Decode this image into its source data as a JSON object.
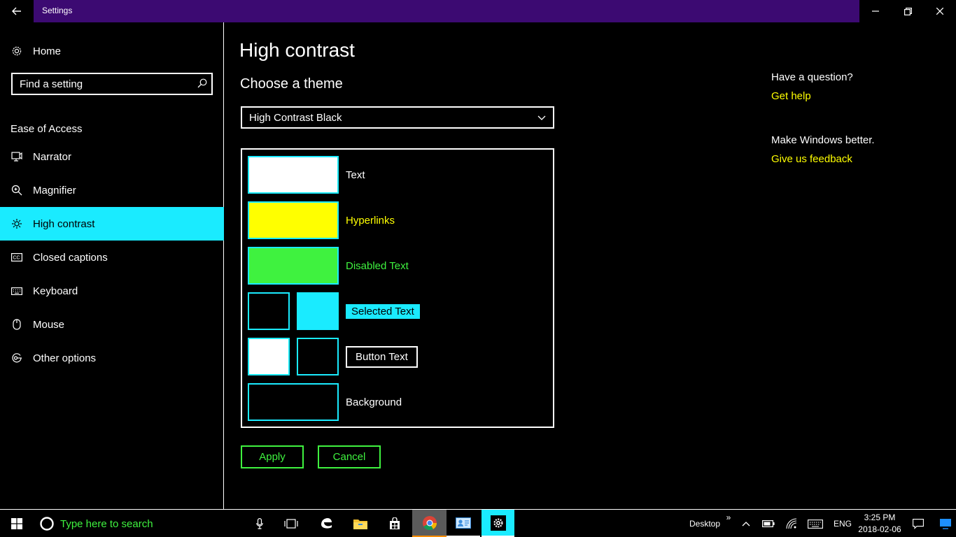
{
  "window": {
    "title": "Settings"
  },
  "sidebar": {
    "home_label": "Home",
    "search_placeholder": "Find a setting",
    "section_title": "Ease of Access",
    "items": [
      {
        "label": "Narrator",
        "icon": "narrator-icon"
      },
      {
        "label": "Magnifier",
        "icon": "magnifier-icon"
      },
      {
        "label": "High contrast",
        "icon": "high-contrast-icon",
        "active": true
      },
      {
        "label": "Closed captions",
        "icon": "closed-captions-icon"
      },
      {
        "label": "Keyboard",
        "icon": "keyboard-icon"
      },
      {
        "label": "Mouse",
        "icon": "mouse-icon"
      },
      {
        "label": "Other options",
        "icon": "other-options-icon"
      }
    ]
  },
  "main": {
    "title": "High contrast",
    "subtitle": "Choose a theme",
    "theme_select": {
      "value": "High Contrast Black"
    },
    "swatches": {
      "text_label": "Text",
      "hyperlinks_label": "Hyperlinks",
      "disabled_label": "Disabled Text",
      "selected_label": "Selected Text",
      "button_label": "Button Text",
      "background_label": "Background"
    },
    "colors": {
      "text": "#ffffff",
      "hyperlinks": "#ffff00",
      "disabled": "#3ff23f",
      "selected_bg": "#1aebff",
      "background": "#000000",
      "accent_border": "#1aebff"
    },
    "apply_label": "Apply",
    "cancel_label": "Cancel"
  },
  "help": {
    "question": "Have a question?",
    "get_help": "Get help",
    "make_better": "Make Windows better.",
    "feedback": "Give us feedback"
  },
  "taskbar": {
    "search_placeholder": "Type here to search",
    "desktop_label": "Desktop",
    "language": "ENG",
    "time": "3:25 PM",
    "date": "2018-02-06"
  }
}
